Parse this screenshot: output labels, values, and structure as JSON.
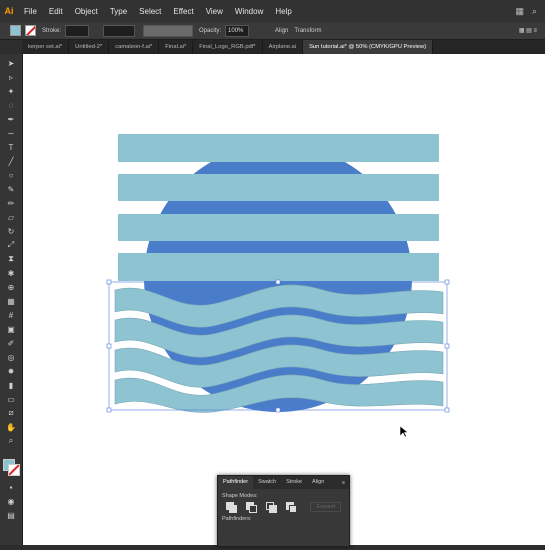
{
  "menubar": {
    "logo": "Ai",
    "items": [
      "File",
      "Edit",
      "Object",
      "Type",
      "Select",
      "Effect",
      "View",
      "Window",
      "Help"
    ],
    "right_icons": [
      "arrange-icon",
      "search-icon"
    ]
  },
  "controlbar": {
    "fill_color": "#8ec3d2",
    "stroke_label": "Stroke:",
    "opacity_label": "Opacity:",
    "opacity_value": "100%",
    "align_label": "Align",
    "transform_label": "Transform"
  },
  "tabs": [
    {
      "label": "kerper set.ai*",
      "active": false
    },
    {
      "label": "Untitled-2*",
      "active": false
    },
    {
      "label": "camaleon-f.ai*",
      "active": false
    },
    {
      "label": "Final.ai*",
      "active": false
    },
    {
      "label": "Final_Logo_RGB.pdf*",
      "active": false
    },
    {
      "label": "Airplane.ai",
      "active": false
    },
    {
      "label": "Sun tutorial.ai* @ 50% (CMYK/GPU Preview)",
      "active": true
    }
  ],
  "artwork": {
    "stripe_color": "#8ec3d2",
    "sun_color": "#4a7dc9",
    "wave_color": "#8ec3d2",
    "selection_color": "#4f7ae3"
  },
  "panel": {
    "tabs": [
      {
        "label": "Pathfinder",
        "active": true
      },
      {
        "label": "Swatch",
        "active": false
      },
      {
        "label": "Stroke",
        "active": false
      },
      {
        "label": "Align",
        "active": false
      }
    ],
    "menu_icon": "panel-menu-icon",
    "shape_modes_label": "Shape Modes:",
    "expand_label": "Expand",
    "pathfinders_label": "Pathfinders:"
  }
}
